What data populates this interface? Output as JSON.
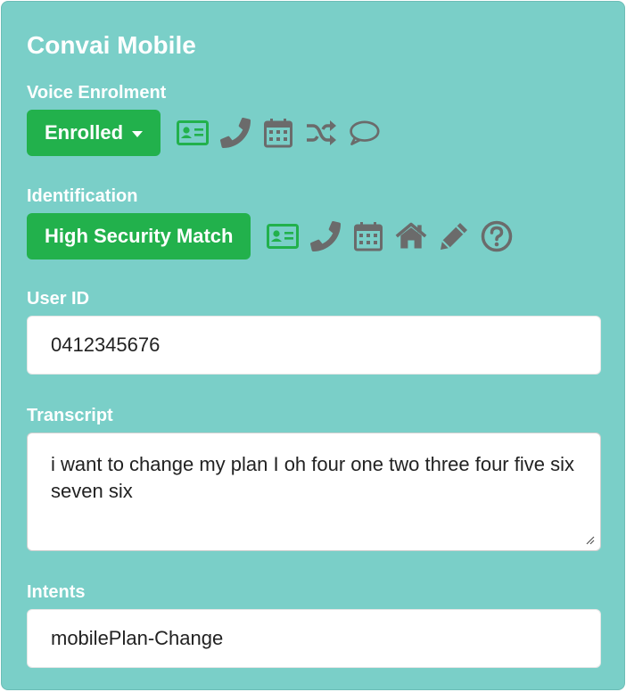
{
  "app": {
    "title": "Convai Mobile"
  },
  "voice_enrolment": {
    "label": "Voice Enrolment",
    "status_label": "Enrolled",
    "icons": [
      {
        "name": "id-card-icon",
        "color": "#22b14c"
      },
      {
        "name": "phone-icon",
        "color": "#6b6b6b"
      },
      {
        "name": "calendar-icon",
        "color": "#6b6b6b"
      },
      {
        "name": "shuffle-icon",
        "color": "#6b6b6b"
      },
      {
        "name": "chat-bubble-icon",
        "color": "#6b6b6b"
      }
    ]
  },
  "identification": {
    "label": "Identification",
    "status_label": "High Security Match",
    "icons": [
      {
        "name": "id-card-icon",
        "color": "#22b14c"
      },
      {
        "name": "phone-icon",
        "color": "#6b6b6b"
      },
      {
        "name": "calendar-icon",
        "color": "#6b6b6b"
      },
      {
        "name": "home-icon",
        "color": "#6b6b6b"
      },
      {
        "name": "pencil-icon",
        "color": "#6b6b6b"
      },
      {
        "name": "question-circle-icon",
        "color": "#6b6b6b"
      }
    ]
  },
  "user_id": {
    "label": "User ID",
    "value": "0412345676"
  },
  "transcript": {
    "label": "Transcript",
    "value": "i want to change my plan I oh four one two three four five six seven six"
  },
  "intents": {
    "label": "Intents",
    "value": "mobilePlan-Change"
  },
  "colors": {
    "panel_bg": "#7acfc8",
    "accent_green": "#22b14c",
    "icon_grey": "#6b6b6b",
    "text_white": "#ffffff"
  }
}
